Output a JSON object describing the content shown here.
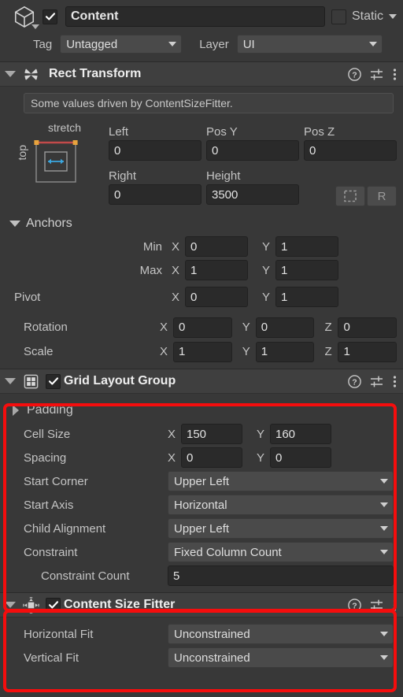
{
  "gameobject": {
    "icon": "cube-icon",
    "enabled_checkbox": true,
    "name": "Content",
    "name_placeholder": "Name",
    "static_label": "Static",
    "static_checked": false,
    "tag_label": "Tag",
    "tag_value": "Untagged",
    "layer_label": "Layer",
    "layer_value": "UI"
  },
  "rect_transform": {
    "title": "Rect Transform",
    "icon": "rect-transform-icon",
    "expanded": true,
    "info_message": "Some values driven by ContentSizeFitter.",
    "anchor_preset": {
      "horizontal_label": "stretch",
      "vertical_label": "top"
    },
    "columns": [
      "Left",
      "Pos Y",
      "Pos Z"
    ],
    "values_row1": [
      "0",
      "0",
      "0"
    ],
    "columns2": [
      "Right",
      "Height"
    ],
    "values_row2": [
      "0",
      "3500"
    ],
    "blueprint_button": "blueprint-mode",
    "raw_button": "R",
    "anchors": {
      "title": "Anchors",
      "min_label": "Min",
      "min_x": "0",
      "min_y": "1",
      "max_label": "Max",
      "max_x": "1",
      "max_y": "1"
    },
    "pivot": {
      "label": "Pivot",
      "x": "0",
      "y": "1"
    },
    "rotation": {
      "label": "Rotation",
      "x": "0",
      "y": "0",
      "z": "0"
    },
    "scale": {
      "label": "Scale",
      "x": "1",
      "y": "1",
      "z": "1"
    },
    "axis_x": "X",
    "axis_y": "Y",
    "axis_z": "Z"
  },
  "grid_layout_group": {
    "title": "Grid Layout Group",
    "icon": "grid-layout-icon",
    "expanded": true,
    "enabled_checkbox": true,
    "padding_label": "Padding",
    "padding_expanded": false,
    "cell_size": {
      "label": "Cell Size",
      "x": "150",
      "y": "160"
    },
    "spacing": {
      "label": "Spacing",
      "x": "0",
      "y": "0"
    },
    "start_corner": {
      "label": "Start Corner",
      "value": "Upper Left"
    },
    "start_axis": {
      "label": "Start Axis",
      "value": "Horizontal"
    },
    "child_alignment": {
      "label": "Child Alignment",
      "value": "Upper Left"
    },
    "constraint": {
      "label": "Constraint",
      "value": "Fixed Column Count"
    },
    "constraint_count": {
      "label": "Constraint Count",
      "value": "5"
    },
    "axis_x": "X",
    "axis_y": "Y"
  },
  "content_size_fitter": {
    "title": "Content Size Fitter",
    "icon": "content-size-fitter-icon",
    "expanded": true,
    "enabled_checkbox": true,
    "horizontal_fit": {
      "label": "Horizontal Fit",
      "value": "Unconstrained"
    },
    "vertical_fit": {
      "label": "Vertical Fit",
      "value": "Unconstrained"
    }
  },
  "highlight": {
    "color": "#f50d0d"
  }
}
